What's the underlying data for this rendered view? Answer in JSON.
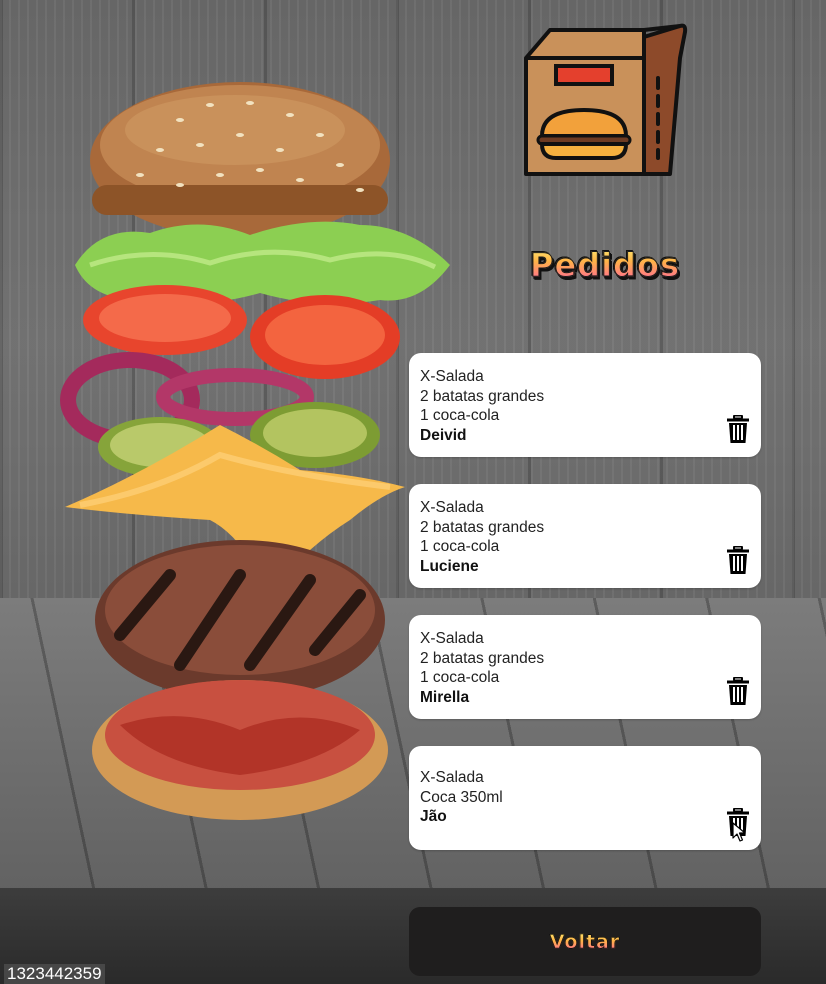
{
  "watermark": "1323442359",
  "header": {
    "logo_icon": "burger-bag-icon",
    "title": "Pedidos"
  },
  "orders": [
    {
      "items": [
        "X-Salada",
        "2 batatas grandes",
        "1 coca-cola"
      ],
      "customer": "Deivid",
      "delete_icon": "trash-icon"
    },
    {
      "items": [
        "X-Salada",
        "2 batatas grandes",
        "1 coca-cola"
      ],
      "customer": "Luciene",
      "delete_icon": "trash-icon"
    },
    {
      "items": [
        "X-Salada",
        "2 batatas grandes",
        "1 coca-cola"
      ],
      "customer": "Mirella",
      "delete_icon": "trash-icon"
    },
    {
      "items": [
        "X-Salada",
        "Coca 350ml"
      ],
      "customer": "Jão",
      "delete_icon": "trash-icon"
    }
  ],
  "footer": {
    "back_label": "Voltar"
  },
  "colors": {
    "card_bg": "#ffffff",
    "button_bg": "#1f1e1e",
    "title_gradient_top": "#fff176",
    "title_gradient_bottom": "#ff5fa2"
  }
}
